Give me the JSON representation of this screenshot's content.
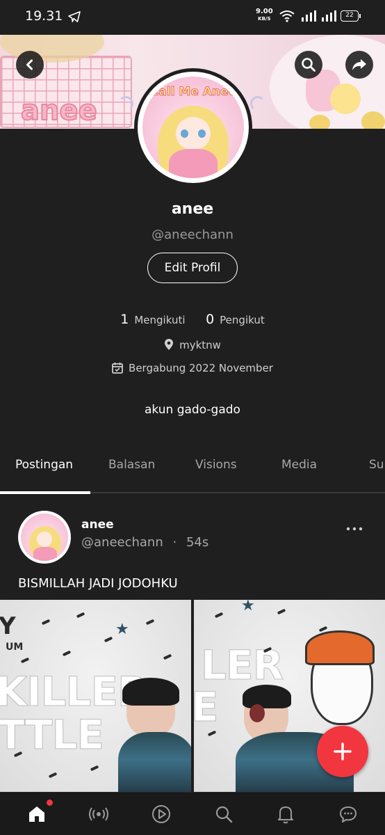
{
  "status_bar": {
    "time": "19.31",
    "net_speed_value": "9.00",
    "net_speed_unit": "KB/S",
    "battery": "22"
  },
  "profile": {
    "banner_text": "anee",
    "avatar_caption": "Call Me Anee",
    "name": "anee",
    "handle": "@aneechann",
    "edit_button": "Edit Profil",
    "following_count": "1",
    "following_label": "Mengikuti",
    "followers_count": "0",
    "followers_label": "Pengikut",
    "location": "myktnw",
    "joined": "Bergabung 2022 November",
    "bio": "akun gado-gado"
  },
  "tabs": [
    {
      "label": "Postingan",
      "active": true
    },
    {
      "label": "Balasan",
      "active": false
    },
    {
      "label": "Visions",
      "active": false
    },
    {
      "label": "Media",
      "active": false
    },
    {
      "label": "Su",
      "active": false
    }
  ],
  "post": {
    "author_name": "anee",
    "author_handle": "@aneechann",
    "separator": "·",
    "time_ago": "54s",
    "text": "BISMILLAH JADI JODOHKU",
    "image1_text": [
      "Y",
      "UM",
      "KILLER",
      "TTLE"
    ],
    "image2_text": [
      "LER",
      "E"
    ]
  },
  "colors": {
    "background": "#1f1f1f",
    "accent": "#f2363f",
    "muted_text": "#a8a8a8"
  },
  "icons": {
    "back": "chevron-left-icon",
    "search": "search-icon",
    "share": "share-icon",
    "location": "location-pin-icon",
    "calendar": "calendar-icon",
    "more": "more-horizontal-icon",
    "fab": "plus-icon",
    "nav": [
      "home-icon",
      "live-icon",
      "play-icon",
      "search-icon",
      "bell-icon",
      "chat-icon"
    ]
  }
}
